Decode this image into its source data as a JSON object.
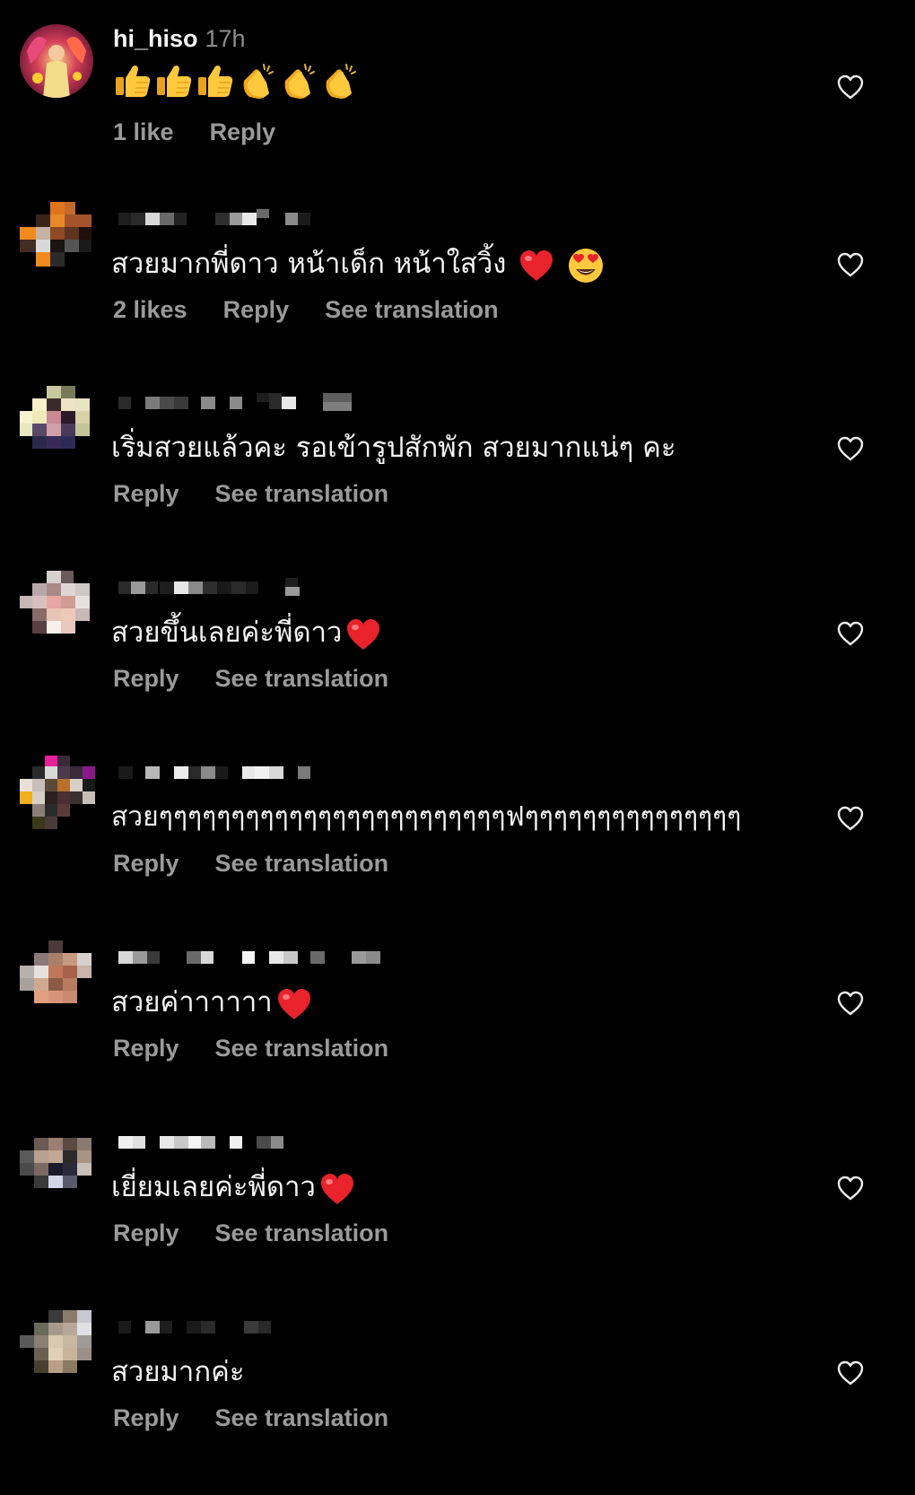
{
  "comments": [
    {
      "username": "hi_hiso",
      "time": "17h",
      "text": "👍👍👍👏👏👏",
      "likes_label": "1 like",
      "reply_label": "Reply",
      "translation_label": ""
    },
    {
      "username": "",
      "time": "",
      "text": "สวยมากพี่ดาว หน้าเด็ก หน้าใสวิ้ง",
      "likes_label": "2 likes",
      "reply_label": "Reply",
      "translation_label": "See translation"
    },
    {
      "username": "",
      "time": "",
      "text": "เริ่มสวยแล้วคะ  รอเข้ารูปสักพัก  สวยมากแน่ๆ คะ",
      "likes_label": "",
      "reply_label": "Reply",
      "translation_label": "See translation"
    },
    {
      "username": "",
      "time": "",
      "text": "สวยขึ้นเลยค่ะพี่ดาว",
      "likes_label": "",
      "reply_label": "Reply",
      "translation_label": "See translation"
    },
    {
      "username": "",
      "time": "",
      "text": "สวยๆๆๆๆๆๆๆๆๆๆๆๆๆๆๆๆๆๆๆๆๆๆๆๆฟๆๆๆๆๆๆๆๆๆๆๆๆๆๆๆ",
      "likes_label": "",
      "reply_label": "Reply",
      "translation_label": "See translation"
    },
    {
      "username": "",
      "time": "",
      "text": "สวยค่าาาาาา",
      "likes_label": "",
      "reply_label": "Reply",
      "translation_label": "See translation"
    },
    {
      "username": "",
      "time": "",
      "text": "เยี่ยมเลยค่ะพี่ดาว",
      "likes_label": "",
      "reply_label": "Reply",
      "translation_label": "See translation"
    },
    {
      "username": "",
      "time": "",
      "text": "สวยมากค่ะ",
      "likes_label": "",
      "reply_label": "Reply",
      "translation_label": "See translation"
    }
  ],
  "icons": {
    "like": "heart-outline-icon",
    "thumbs_up": "thumbs-up-emoji",
    "clapping": "clapping-hands-emoji",
    "red_heart": "red-heart-emoji",
    "heart_eyes": "heart-eyes-emoji"
  },
  "colors": {
    "background": "#000000",
    "primary_text": "#f5f5f5",
    "secondary_text": "#9a9a9a",
    "red_heart": "#e8232b"
  }
}
